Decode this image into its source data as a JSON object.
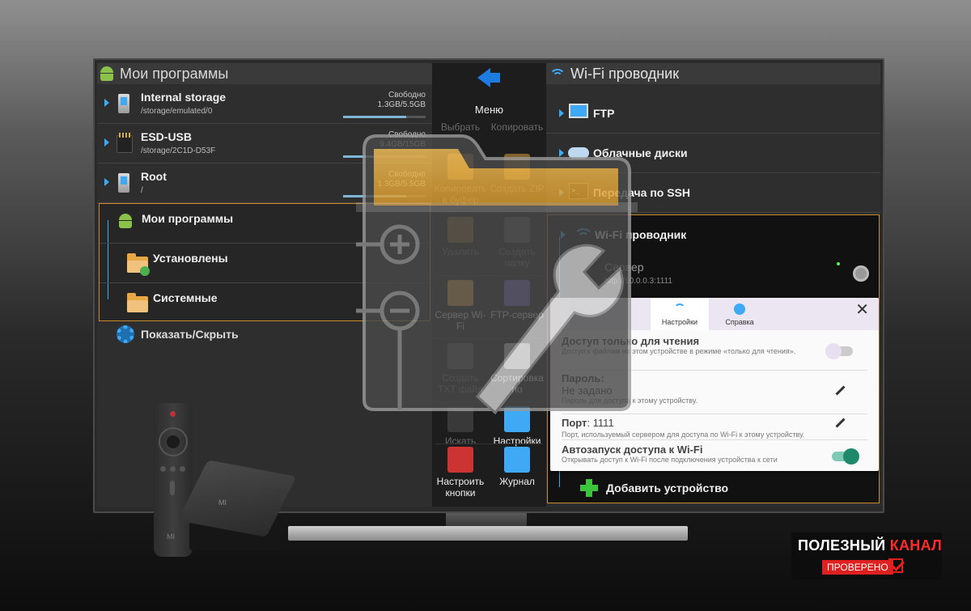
{
  "left": {
    "title": "Мои программы",
    "storage": [
      {
        "name": "Internal storage",
        "path": "/storage/emulated/0",
        "free_label": "Свободно",
        "free": "1.3GB/5.5GB",
        "used": 0.76
      },
      {
        "name": "ESD-USB",
        "path": "/storage/2C1D-D53F",
        "free_label": "Свободно",
        "free": "9.4GB/15GB",
        "used": 0.37
      },
      {
        "name": "Root",
        "path": "/",
        "free_label": "Свободно",
        "free": "1.3GB/5.5GB",
        "used": 0.76
      }
    ],
    "apps_group": {
      "title": "Мои программы",
      "installed": "Установлены",
      "system": "Системные"
    },
    "show_hide": "Показать/Скрыть"
  },
  "menu": {
    "title": "Меню",
    "items": [
      {
        "label": "Выбрать",
        "dim": true
      },
      {
        "label": "Копировать",
        "dim": true
      },
      {
        "label": "Копировать в буфер",
        "dim": true
      },
      {
        "label": "Создать ZIP",
        "dim": true
      },
      {
        "label": "Удалить",
        "dim": true
      },
      {
        "label": "Создать папку",
        "dim": true
      },
      {
        "label": "Сервер Wi-Fi",
        "dim": false
      },
      {
        "label": "FTP-сервер",
        "dim": false
      },
      {
        "label": "Создать TXT файл",
        "dim": true
      },
      {
        "label": "Сортировка по",
        "dim": false
      },
      {
        "label": "Искать",
        "dim": true
      },
      {
        "label": "Настройки",
        "dim": false
      },
      {
        "label": "Настроить кнопки",
        "dim": false
      },
      {
        "label": "Журнал",
        "dim": false
      }
    ]
  },
  "right": {
    "title": "Wi-Fi проводник",
    "items": [
      "FTP",
      "Облачные диски",
      "Передача по SSH"
    ],
    "wifi_group": {
      "title": "Wi-Fi проводник",
      "server_name": "Сервер",
      "server_url": "http://10.0.0.3:1111",
      "add_device": "Добавить устройство"
    }
  },
  "dialog": {
    "tabs": [
      "Настройки",
      "Справка"
    ],
    "close": "✕",
    "read_only": {
      "title": "Доступ только для чтения",
      "desc": "Доступ к файлам на этом устройстве в режиме «только для чтения».",
      "enabled": false
    },
    "password": {
      "title": "Пароль:",
      "value": "Не задано",
      "desc": "Пароль для доступа к этому устройству."
    },
    "port": {
      "title": "Порт",
      "value": "1111",
      "desc": "Порт, используемый сервером для доступа по Wi-Fi к этому устройству."
    },
    "autostart": {
      "title": "Автозапуск доступа к Wi-Fi",
      "desc": "Открывать доступ к Wi-Fi после подключения устройства к сети",
      "enabled": true
    }
  },
  "hardware": {
    "remote_logo": "MI",
    "box_logo": "MI"
  },
  "watermark": {
    "line1_white": "ПОЛЕЗНЫЙ",
    "line1_red": "КАНАЛ",
    "badge": "ПРОВЕРЕНО"
  },
  "colors": {
    "accent": "#3fa9f5",
    "highlight": "#c98b2b",
    "switch_on": "#1f8a6a",
    "brand_red": "#e02020"
  }
}
